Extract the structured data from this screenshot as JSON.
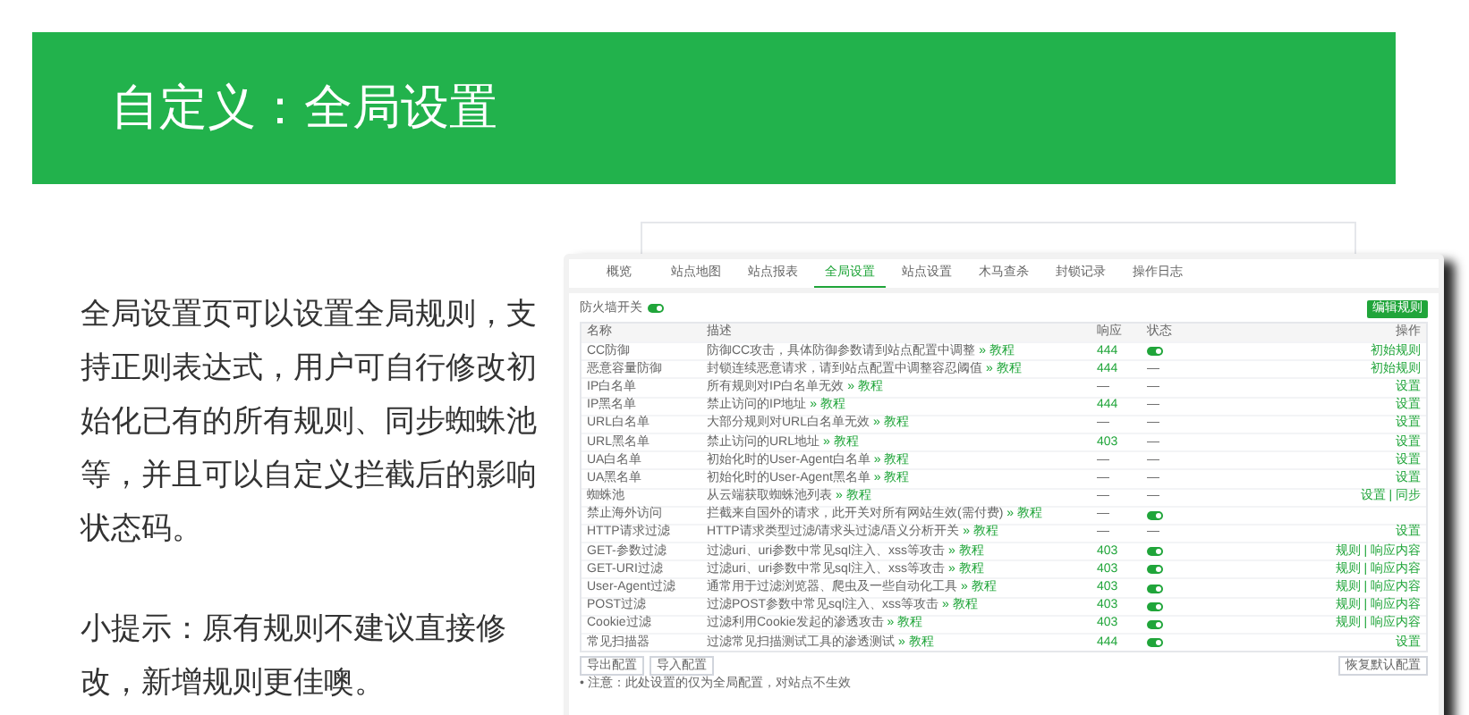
{
  "header": {
    "title": "自定义：全局设置"
  },
  "paragraphs": [
    "全局设置页可以设置全局规则，支持正则表达式，用户可自行修改初始化已有的所有规则、同步蜘蛛池等，并且可以自定义拦截后的影响状态码。",
    "小提示：原有规则不建议直接修改，新增规则更佳噢。"
  ],
  "screenshot": {
    "tabs": [
      {
        "label": "概览",
        "selected": false
      },
      {
        "label": "站点地图",
        "selected": false
      },
      {
        "label": "站点报表",
        "selected": false
      },
      {
        "label": "全局设置",
        "selected": true
      },
      {
        "label": "站点设置",
        "selected": false
      },
      {
        "label": "木马查杀",
        "selected": false
      },
      {
        "label": "封锁记录",
        "selected": false
      },
      {
        "label": "操作日志",
        "selected": false
      }
    ],
    "firewall_switch": {
      "label": "防火墙开关",
      "on": true
    },
    "top_button": "编辑规则",
    "columns": [
      "名称",
      "描述",
      "响应",
      "状态",
      "操作"
    ],
    "rows": [
      {
        "name": "CC防御",
        "desc": "防御CC攻击，具体防御参数请到站点配置中调整",
        "link": "» 教程",
        "response": "444",
        "kind": "toggle",
        "on": true,
        "action": "初始规则"
      },
      {
        "name": "恶意容量防御",
        "desc": "封锁连续恶意请求，请到站点配置中调整容忍阈值",
        "link": "» 教程",
        "response": "444",
        "kind": "text",
        "status": "—",
        "action": "初始规则"
      },
      {
        "name": "IP白名单",
        "desc": "所有规则对IP白名单无效",
        "link": "» 教程",
        "response": "—",
        "kind": "text",
        "status": "—",
        "action": "设置"
      },
      {
        "name": "IP黑名单",
        "desc": "禁止访问的IP地址",
        "link": "» 教程",
        "response": "444",
        "kind": "text",
        "status": "—",
        "action": "设置"
      },
      {
        "name": "URL白名单",
        "desc": "大部分规则对URL白名单无效",
        "link": "» 教程",
        "response": "—",
        "kind": "text",
        "status": "—",
        "action": "设置"
      },
      {
        "name": "URL黑名单",
        "desc": "禁止访问的URL地址",
        "link": "» 教程",
        "response": "403",
        "kind": "text",
        "status": "—",
        "action": "设置"
      },
      {
        "name": "UA白名单",
        "desc": "初始化时的User-Agent白名单",
        "link": "» 教程",
        "response": "—",
        "kind": "text",
        "status": "—",
        "action": "设置"
      },
      {
        "name": "UA黑名单",
        "desc": "初始化时的User-Agent黑名单",
        "link": "» 教程",
        "response": "—",
        "kind": "text",
        "status": "—",
        "action": "设置"
      },
      {
        "name": "蜘蛛池",
        "desc": "从云端获取蜘蛛池列表",
        "link": "» 教程",
        "response": "—",
        "kind": "text",
        "status": "—",
        "action": "设置 | 同步"
      },
      {
        "name": "禁止海外访问",
        "desc": "拦截来自国外的请求，此开关对所有网站生效(需付费)",
        "link": "» 教程",
        "response": "—",
        "kind": "toggle",
        "on": true,
        "action": ""
      },
      {
        "name": "HTTP请求过滤",
        "desc": "HTTP请求类型过滤/请求头过滤/语义分析开关",
        "link": "» 教程",
        "response": "—",
        "kind": "text",
        "status": "—",
        "action": "设置"
      },
      {
        "name": "GET-参数过滤",
        "desc": "过滤uri、uri参数中常见sql注入、xss等攻击",
        "link": "» 教程",
        "response": "403",
        "kind": "toggle",
        "on": true,
        "action": "规则 | 响应内容"
      },
      {
        "name": "GET-URI过滤",
        "desc": "过滤uri、uri参数中常见sql注入、xss等攻击",
        "link": "» 教程",
        "response": "403",
        "kind": "toggle",
        "on": true,
        "action": "规则 | 响应内容"
      },
      {
        "name": "User-Agent过滤",
        "desc": "通常用于过滤浏览器、爬虫及一些自动化工具",
        "link": "» 教程",
        "response": "403",
        "kind": "toggle",
        "on": true,
        "action": "规则 | 响应内容"
      },
      {
        "name": "POST过滤",
        "desc": "过滤POST参数中常见sql注入、xss等攻击",
        "link": "» 教程",
        "response": "403",
        "kind": "toggle",
        "on": true,
        "action": "规则 | 响应内容"
      },
      {
        "name": "Cookie过滤",
        "desc": "过滤利用Cookie发起的渗透攻击",
        "link": "» 教程",
        "response": "403",
        "kind": "toggle",
        "on": true,
        "action": "规则 | 响应内容"
      },
      {
        "name": "常见扫描器",
        "desc": "过滤常见扫描测试工具的渗透测试",
        "link": "» 教程",
        "response": "444",
        "kind": "toggle",
        "on": true,
        "action": "设置"
      }
    ],
    "bottom_buttons": [
      "导出配置",
      "导入配置"
    ],
    "reset_button": "恢复默认配置",
    "note": "• 注意：此处设置的仅为全局配置，对站点不生效"
  }
}
